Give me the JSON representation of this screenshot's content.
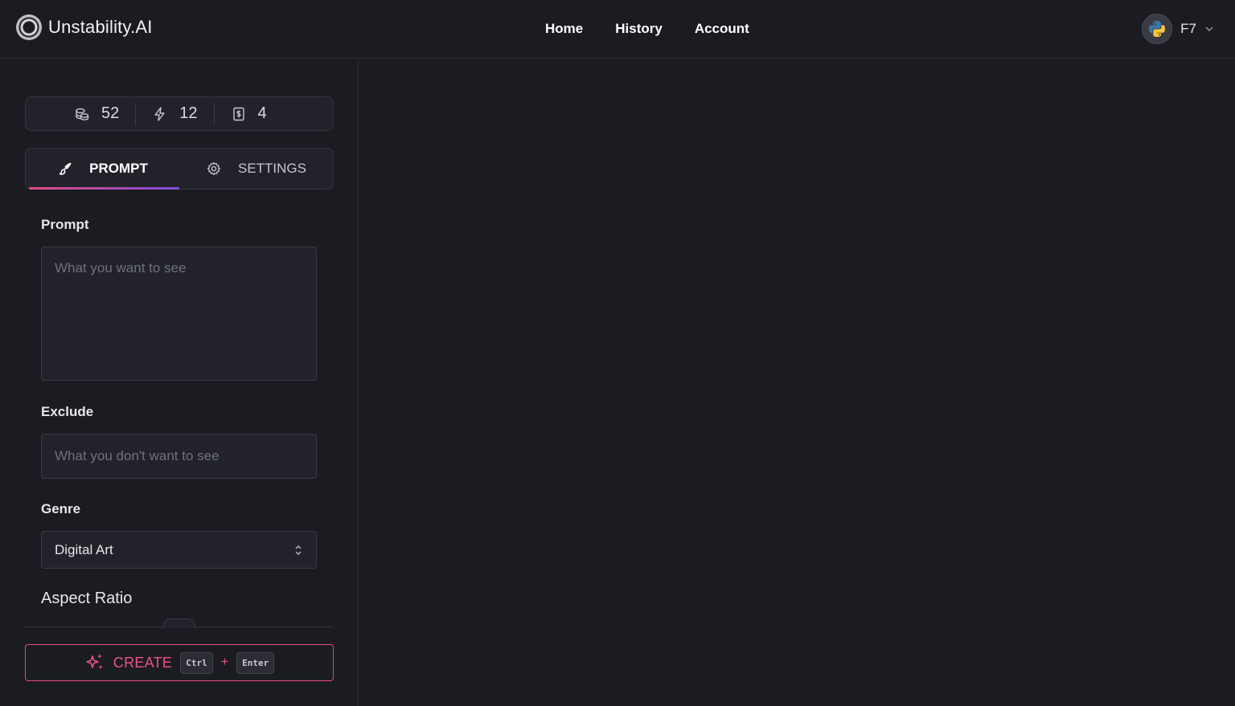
{
  "app": {
    "brand": "Unstability.AI"
  },
  "nav": {
    "items": [
      "Home",
      "History",
      "Account"
    ]
  },
  "user": {
    "name": "F7"
  },
  "stats": {
    "credits": "52",
    "fast": "12",
    "limit": "4"
  },
  "tabs": {
    "prompt": "PROMPT",
    "settings": "SETTINGS"
  },
  "form": {
    "prompt_label": "Prompt",
    "prompt_placeholder": "What you want to see",
    "exclude_label": "Exclude",
    "exclude_placeholder": "What you don't want to see",
    "genre_label": "Genre",
    "genre_value": "Digital Art",
    "aspect_label": "Aspect Ratio"
  },
  "create": {
    "label": "CREATE",
    "key1": "Ctrl",
    "plus": "+",
    "key2": "Enter"
  },
  "colors": {
    "accent": "#e8497f",
    "accent2": "#7b4ddb",
    "bg": "#1b1c22",
    "panel": "#22232a"
  }
}
